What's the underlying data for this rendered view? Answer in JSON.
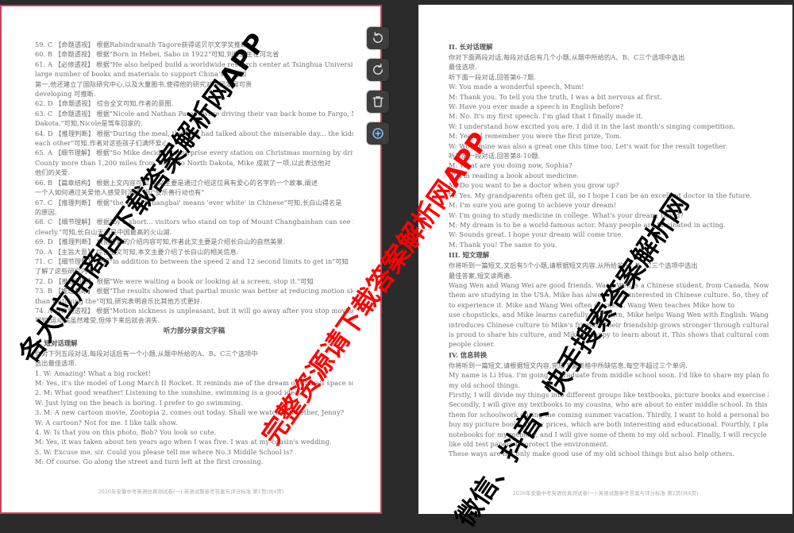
{
  "left_page": {
    "lines": [
      "59. C 【命题透视】 根据Rabindranath Tagore获得诺贝尔文学奖推断",
      "60. B 【命题透视】 根据\"Born in Hebei, Sabo in 1922\"可知,刘辉出生在河北省",
      "61. A 【必修透视】 根据\"He also helped build a worldwide research center at Tsinghua University, a",
      "large number of books and materials to support China's...\"可知",
      "第一,他还建立了国际研究中心,以及大量图书,使得他的研究对中国发展可贵",
      "developing 可推断.",
      "62. D 【命题透视】 综合全文可知,作者的意图.",
      "63. C 【命题透视】 根据\"Nicole and Nathan Parent were driving their van back home to Fargo, North",
      "Dakota.\"可知,Nicole是驾车回家的.",
      "64. D 【推理判断】 根据\"During the meal, the kids had talked about the miserable day... the kids' love for",
      "each other\"可知,作者对这些孩子们满怀爱心.",
      "65. A 【细节理解】 根据\"So Mike decided to surprise every station on Christmas morning by driving",
      "County more than 1,200 miles from Texas to North Dakota, Mike 成就了一项,以此表达他对",
      "他们的关爱.",
      "66. B 【篇章结构】 根据上文内容可知,本文主要是通过介绍这位具有爱心的名字的一个故事,阐述",
      "一个人如何通过关爱他人感受到温暖.\"即\"使乐善行动也有\"",
      "67. C 【推理判断】 根据\"the word 'Changbai' means 'ever white' in Chinese\"可知,长白山得名是",
      "的原因.",
      "68. C 【细节理解】 根据\"by a short... visitors who stand on top of Mount Changbaishan can see it",
      "clearly.\"可知,长白山天池是中国最高的火山湖.",
      "69. D 【推理判断】 根据文章的介绍内容可知,作者此文主要是介绍长白山的自然美景.",
      "70. A 【主旨大意】 综合全文可知,本文主要介绍了长白山的相关信息.",
      "71. C 【细节理解】 根据\"in addition to between the speed 2 and 12 second limits to get in\"可知",
      "了解了这些研究内容.",
      "72. D 【推理判断】 根据\"We were waiting a book or looking at a screen, stop it.\"可知",
      "73. B 【推理判断】 根据\"The results showed that partial music was better at reducing motion sickness",
      "than watching the\"可知,研究表明音乐比其他方式更好.",
      "74. A 【命题透视】 根据\"Motion sickness is unpleasant, but it will go away after you stop moving.\"",
      "可知,运动病虽然难受,但停下来后就会消失."
    ],
    "heading": "听力部分录音文字稿",
    "subhead": "1. 短对话理解",
    "lines_b": [
      "你对下列五段对话,每段对话后有一个小题,从题中所给的A、B、C三个选项中",
      "选出最佳选项.",
      "1. W: Amazing! What a big rocket!",
      "M: Yes, it's the model of Long March II Rocket. It reminds me of the dream of China's space science.",
      "2. M: What good weather! Listening to the sunshine, swimming is a good idea.",
      "W: Just lying on the beach is boring. I prefer to go swimming.",
      "3. M: A new cartoon movie, Zootopia 2, comes out today. Shall we watch it together, Jenny?",
      "W: A cartoon? Not for me. I like talk show.",
      "4. W: Is that you on this photo, Bob? You look so cute.",
      "M: Yes, it was taken about ten years ago when I was five. I was at my cousin's wedding.",
      "5. W: Excuse me, sir. Could you please tell me where No.3 Middle School is?",
      "M: Of course. Go along the street and turn left at the first crossing."
    ],
    "footer": "2026年安徽中考英语仿真测试卷(一)·英语试题参考答案与评分标准 第1页(共4页)"
  },
  "right_page": {
    "subhead_1": "II. 长对话理解",
    "lines": [
      "你对下面两段对话,每段对话后有几个小题,从题中所给的A、B、C三个选项中选出",
      "最佳选项.",
      "听下面一段对话,回答第6-7题.",
      "W: You made a wonderful speech, Mum!",
      "M: Thank you. To tell you the truth, I was a bit nervous at first.",
      "W: Have you ever made a speech in English before?",
      "M: No. It's my first speech. I'm glad that I finally made it.",
      "W: I understand how excited you are. I did it in the last month's singing competition.",
      "M: Yeah. I remember you were the first prize, Tom.",
      "W: Wow, mine was also a great one this time too. Let's wait for the result together.",
      "听下面一段对话,回答第8-10题.",
      "M: What are you doing now, Sophia?",
      "W: I'm reading a book about medicine.",
      "M: Do you want to be a doctor when you grow up?",
      "W: Yes. My grandparents often get ill, so I hope I can be an excellent doctor in the future.",
      "M: I'm sure you are going to achieve your dream!",
      "W: I'm going to study medicine in college. What's your dream, David?",
      "M: My dream is to be a world-famous actor. Many people are fascinated in acting.",
      "W: Sounds great. I hope your dream will come true.",
      "M: Thank you! The same to you."
    ],
    "subhead_2": "III. 短文理解",
    "lines_b": [
      "你将听到一篇短文,文后有5个小题,请根据短文内容,从所给的A、B、C三个选项中选出",
      "最佳答案,短文读两遍.",
      "Wang Wen and Wang Wei are good friends. Wang Wen is a Chinese student, from Canada. Now both of",
      "them are studying in the USA. Mike has always been interested in Chinese culture. So, they often go to Chinatown",
      "to experience it. Mike and Wang Wei often discuss... Wang Wen teaches Mike how to",
      "use chopsticks, and Mike learns carefully. In return, Mike helps Wang Wen with English. Wang Wen also",
      "introduces Chinese culture to Mike's friends. Their friendship grows stronger through cultural exchanges. Wang Wei",
      "is proud to share his culture, and Mike is happy to learn about it. This shows that cultural communication brings",
      "people closer."
    ],
    "subhead_3": "IV. 信息转换",
    "lines_c": [
      "你将听到一篇短文,请根据短文内容,完成下面表格中所缺信息,每空不超过三个单词.",
      "My name is Li Hua. I'm going to graduate from middle school soon. I'd like to share my plan for dealing with",
      "my old school things.",
      "Firstly, I will divide my things into different groups like textbooks, picture books and exercise books.",
      "Secondly, I will give my textbooks to my cousins, who are about to enter middle school. In this way, they can use",
      "them for schoolwork during the coming summer vacation. Thirdly, I want to hold a personal book sale. Children can",
      "buy my picture books at low prices, which are both interesting and educational. Fourthly, I plan to keep my",
      "notebooks for my memory, and I will give some of them to my old school. Finally, I will recycle used paper",
      "like old test papers to protect the environment.",
      "These ways are not only make good use of my old school things but also help others."
    ],
    "footer": "2026年安徽中考英语仿真测试卷(一)·英语试题参考答案与评分标准 第2页(共4页)"
  },
  "toolbar": {
    "rotate_ccw": "rotate-ccw-icon",
    "rotate_cw": "rotate-cw-icon",
    "delete": "trash-icon",
    "add": "add-icon"
  },
  "watermarks": {
    "black_1": "各大应用商店下载答案解析网APP",
    "red": "完整资源请下载答案解析网APP",
    "black_2": "微信、抖音、快手搜索答案解析网"
  },
  "colors": {
    "selection_border": "#d0405c",
    "watermark_red": "#ff0000",
    "toolbar_bg": "#3d3d3d",
    "add_accent": "#7ec3ff"
  }
}
